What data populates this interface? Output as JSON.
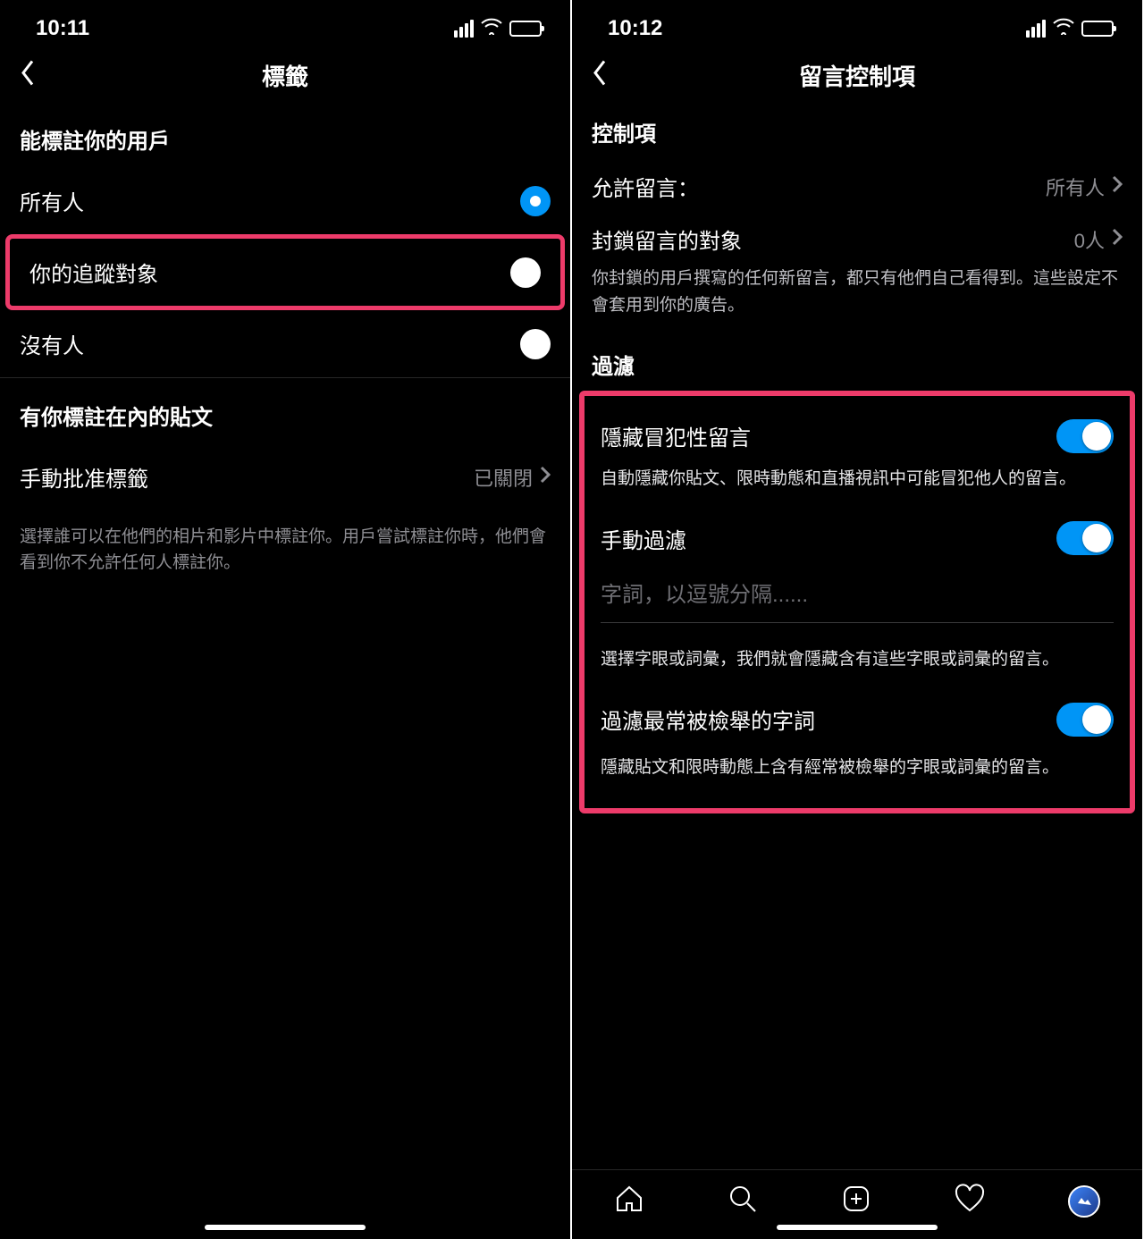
{
  "left": {
    "status_time": "10:11",
    "header_title": "標籤",
    "section1_header": "能標註你的用戶",
    "radio_everyone": "所有人",
    "radio_following": "你的追蹤對象",
    "radio_noone": "沒有人",
    "section2_header": "有你標註在內的貼文",
    "manual_approve_label": "手動批准標籤",
    "manual_approve_value": "已關閉",
    "footnote": "選擇誰可以在他們的相片和影片中標註你。用戶嘗試標註你時，他們會看到你不允許任何人標註你。"
  },
  "right": {
    "status_time": "10:12",
    "header_title": "留言控制項",
    "section_controls": "控制項",
    "allow_comments_label": "允許留言：",
    "allow_comments_value": "所有人",
    "block_comments_label": "封鎖留言的對象",
    "block_comments_value": "0人",
    "block_desc": "你封鎖的用戶撰寫的任何新留言，都只有他們自己看得到。這些設定不會套用到你的廣告。",
    "section_filter": "過濾",
    "hide_offensive_label": "隱藏冒犯性留言",
    "hide_offensive_desc": "自動隱藏你貼文、限時動態和直播視訊中可能冒犯他人的留言。",
    "manual_filter_label": "手動過濾",
    "keywords_placeholder": "字詞，以逗號分隔......",
    "manual_filter_desc": "選擇字眼或詞彙，我們就會隱藏含有這些字眼或詞彙的留言。",
    "common_reported_label": "過濾最常被檢舉的字詞",
    "common_reported_desc": "隱藏貼文和限時動態上含有經常被檢舉的字眼或詞彙的留言。"
  }
}
